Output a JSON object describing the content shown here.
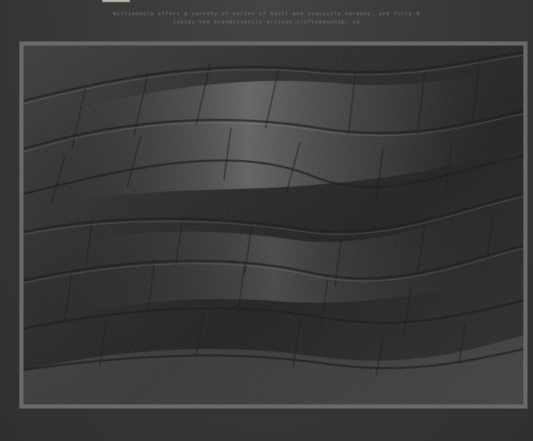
{
  "tagline": {
    "line1": "Williampolo offers a variety of series of multi and exquisite harmony, and fully d",
    "line2": "isplay the brandistently artisan craftsmanship, sd"
  },
  "image": {
    "subject": "black-crocodile-embossed-leather-texture"
  },
  "colors": {
    "background": "#3a3a3a",
    "frame": "#6a6a6a",
    "text": "#7b7b7b"
  }
}
